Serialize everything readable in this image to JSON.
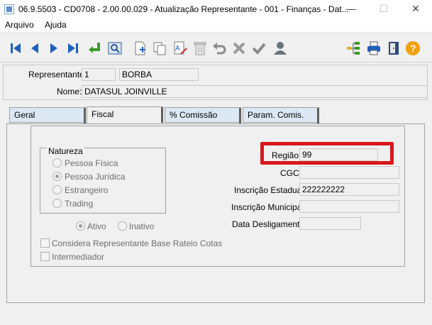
{
  "window": {
    "title": "06.9.5503 - CD0708 - 2.00.00.029 - Atualização Representante - 001 - Finanças - Dat...",
    "minimize_glyph": "—",
    "maximize_glyph": "☐",
    "close_glyph": "✕"
  },
  "menu": {
    "items": [
      "Arquivo",
      "Ajuda"
    ]
  },
  "toolbar": {
    "buttons": [
      "first-record-icon",
      "previous-record-icon",
      "next-record-icon",
      "last-record-icon",
      "goto-icon",
      "search-icon",
      "new-record-icon",
      "copy-record-icon",
      "edit-record-icon",
      "delete-record-icon",
      "undo-icon",
      "cancel-icon",
      "save-icon",
      "user-icon",
      "hierarchy-icon",
      "print-icon",
      "exit-icon",
      "help-icon"
    ]
  },
  "header": {
    "representante_label": "Representante:",
    "representante_code": "1",
    "representante_short_name": "BORBA",
    "nome_label": "Nome:",
    "nome_value": "DATASUL JOINVILLE"
  },
  "tabs": [
    "Geral",
    "Fiscal",
    "% Comissão",
    "Param. Comis."
  ],
  "active_tab": "Fiscal",
  "natureza": {
    "legend": "Natureza",
    "options": [
      "Pessoa Física",
      "Pessoa Jurídica",
      "Estrangeiro",
      "Trading"
    ],
    "selected": "Pessoa Jurídica"
  },
  "status": {
    "options": [
      "Ativo",
      "Inativo"
    ],
    "selected": "Ativo"
  },
  "checkboxes": [
    "Considera Representante Base Rateio Cotas",
    "Intermediador"
  ],
  "fields": {
    "regiao_label": "Região:",
    "regiao_value": "99",
    "cgc_label": "CGC:",
    "cgc_value": "",
    "inscricao_estadual_label": "Inscrição Estadual:",
    "inscricao_estadual_value": "222222222",
    "inscricao_municipal_label": "Inscrição Municipal:",
    "inscricao_municipal_value": "",
    "data_desligamento_label": "Data Desligamento:",
    "data_desligamento_value": ""
  },
  "colors": {
    "highlight": "#d9171d",
    "tab_inactive": "#dde8f5",
    "toolbar_icon_blue": "#1e5fbf"
  }
}
